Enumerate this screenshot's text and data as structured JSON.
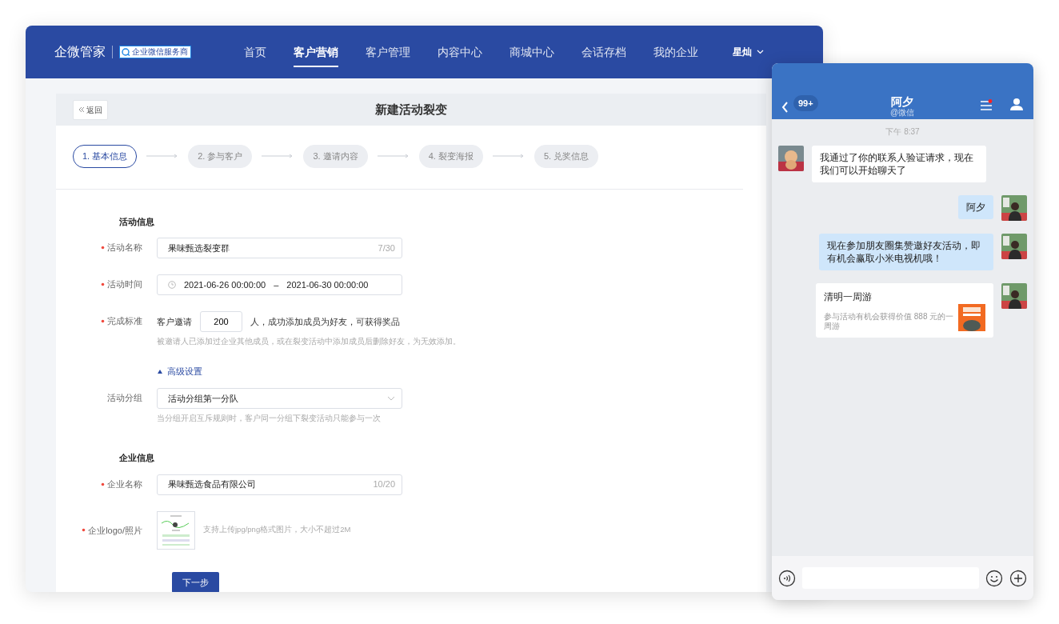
{
  "header": {
    "brand": "企微管家",
    "badge": "企业微信服务商",
    "nav": [
      {
        "label": "首页",
        "selected": false
      },
      {
        "label": "客户营销",
        "selected": true
      },
      {
        "label": "客户管理",
        "selected": false
      },
      {
        "label": "内容中心",
        "selected": false
      },
      {
        "label": "商城中心",
        "selected": false
      },
      {
        "label": "会话存档",
        "selected": false
      },
      {
        "label": "我的企业",
        "selected": false
      }
    ],
    "user": "星灿"
  },
  "page": {
    "back": "返回",
    "title": "新建活动裂变",
    "steps": [
      {
        "label": "1. 基本信息",
        "selected": true
      },
      {
        "label": "2. 参与客户",
        "selected": false
      },
      {
        "label": "3. 邀请内容",
        "selected": false
      },
      {
        "label": "4. 裂变海报",
        "selected": false
      },
      {
        "label": "5. 兑奖信息",
        "selected": false
      }
    ]
  },
  "form": {
    "sections": [
      {
        "title": "活动信息",
        "fields": [
          {
            "kind": "text",
            "label": "活动名称",
            "required": true,
            "value": "果味甄选裂变群",
            "counter": "7/30"
          },
          {
            "kind": "daterange",
            "label": "活动时间",
            "required": true,
            "start": "2021-06-26 00:00:00",
            "separator": "–",
            "end": "2021-06-30 00:00:00"
          },
          {
            "kind": "invite",
            "label": "完成标准",
            "required": true,
            "prefix": "客户邀请",
            "value": "200",
            "suffix": "人，成功添加成员为好友，可获得奖品",
            "hint": "被邀请人已添加过企业其他成员，或在裂变活动中添加成员后删除好友，为无效添加。"
          },
          {
            "kind": "toggle",
            "label": "高级设置",
            "expanded": true
          },
          {
            "kind": "select",
            "label": "活动分组",
            "required": false,
            "value": "活动分组第一分队",
            "hint": "当分组开启互斥规则时，客户同一分组下裂变活动只能参与一次"
          }
        ]
      },
      {
        "title": "企业信息",
        "fields": [
          {
            "kind": "text",
            "label": "企业名称",
            "required": true,
            "value": "果味甄选食品有限公司",
            "counter": "10/20"
          },
          {
            "kind": "upload",
            "label": "企业logo/照片",
            "required": true,
            "hint": "支持上传jpg/png格式图片，大小不超过2M"
          }
        ]
      }
    ],
    "submit": "下一步"
  },
  "chat": {
    "badge": "99+",
    "title": "阿夕",
    "subtitle": "@微信",
    "menu_notice": true,
    "time": "下午 8:37",
    "messages": [
      {
        "kind": "text",
        "outgoing": false,
        "text": "我通过了你的联系人验证请求，现在我们可以开始聊天了"
      },
      {
        "kind": "text",
        "outgoing": true,
        "text": "阿夕"
      },
      {
        "kind": "text",
        "outgoing": true,
        "text": "现在参加朋友圈集赞邀好友活动，即有机会赢取小米电视机哦！"
      },
      {
        "kind": "card",
        "outgoing": true,
        "title": "清明一周游",
        "desc": "参与活动有机会获得价值 888 元的一周游"
      }
    ]
  }
}
